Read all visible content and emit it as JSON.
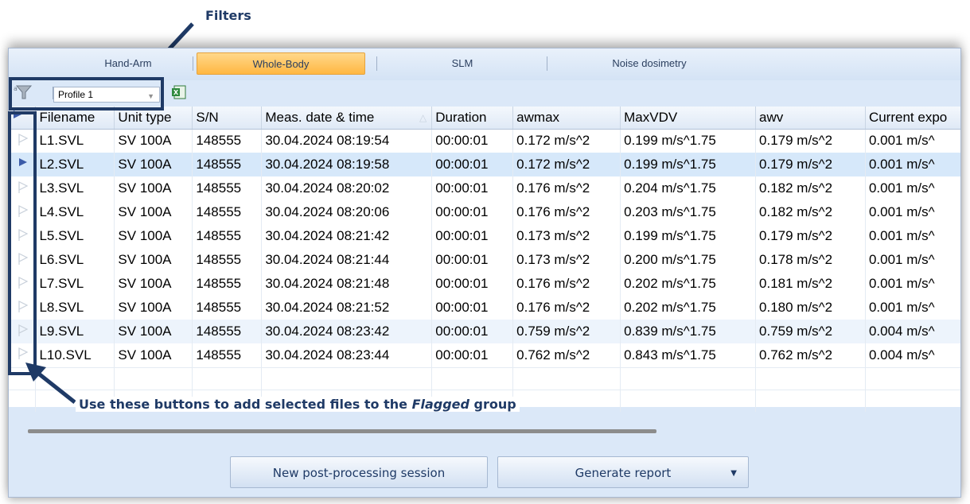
{
  "annotations": {
    "filters_label": "Filters",
    "flag_hint_prefix": "Use these buttons to add selected files to the ",
    "flag_hint_em": "Flagged",
    "flag_hint_suffix": " group"
  },
  "tabs": [
    "Hand-Arm",
    "Whole-Body",
    "SLM",
    "Noise dosimetry"
  ],
  "active_tab": "Whole-Body",
  "toolbar": {
    "profile_value": "Profile 1"
  },
  "table": {
    "columns": [
      "Filename",
      "Unit type",
      "S/N",
      "Meas. date & time",
      "Duration",
      "awmax",
      "MaxVDV",
      "awv",
      "Current expo"
    ],
    "rows": [
      [
        "L1.SVL",
        "SV 100A",
        "148555",
        "30.04.2024 08:19:54",
        "00:00:01",
        "0.172 m/s^2",
        "0.199 m/s^1.75",
        "0.179 m/s^2",
        "0.001 m/s^"
      ],
      [
        "L2.SVL",
        "SV 100A",
        "148555",
        "30.04.2024 08:19:58",
        "00:00:01",
        "0.172 m/s^2",
        "0.199 m/s^1.75",
        "0.179 m/s^2",
        "0.001 m/s^"
      ],
      [
        "L3.SVL",
        "SV 100A",
        "148555",
        "30.04.2024 08:20:02",
        "00:00:01",
        "0.176 m/s^2",
        "0.204 m/s^1.75",
        "0.182 m/s^2",
        "0.001 m/s^"
      ],
      [
        "L4.SVL",
        "SV 100A",
        "148555",
        "30.04.2024 08:20:06",
        "00:00:01",
        "0.176 m/s^2",
        "0.203 m/s^1.75",
        "0.182 m/s^2",
        "0.001 m/s^"
      ],
      [
        "L5.SVL",
        "SV 100A",
        "148555",
        "30.04.2024 08:21:42",
        "00:00:01",
        "0.173 m/s^2",
        "0.199 m/s^1.75",
        "0.179 m/s^2",
        "0.001 m/s^"
      ],
      [
        "L6.SVL",
        "SV 100A",
        "148555",
        "30.04.2024 08:21:44",
        "00:00:01",
        "0.173 m/s^2",
        "0.200 m/s^1.75",
        "0.178 m/s^2",
        "0.001 m/s^"
      ],
      [
        "L7.SVL",
        "SV 100A",
        "148555",
        "30.04.2024 08:21:48",
        "00:00:01",
        "0.176 m/s^2",
        "0.202 m/s^1.75",
        "0.181 m/s^2",
        "0.001 m/s^"
      ],
      [
        "L8.SVL",
        "SV 100A",
        "148555",
        "30.04.2024 08:21:52",
        "00:00:01",
        "0.176 m/s^2",
        "0.202 m/s^1.75",
        "0.180 m/s^2",
        "0.001 m/s^"
      ],
      [
        "L9.SVL",
        "SV 100A",
        "148555",
        "30.04.2024 08:23:42",
        "00:00:01",
        "0.759 m/s^2",
        "0.839 m/s^1.75",
        "0.759 m/s^2",
        "0.004 m/s^"
      ],
      [
        "L10.SVL",
        "SV 100A",
        "148555",
        "30.04.2024 08:23:44",
        "00:00:01",
        "0.762 m/s^2",
        "0.843 m/s^1.75",
        "0.762 m/s^2",
        "0.004 m/s^"
      ]
    ],
    "flagged_row": 1,
    "alt_row": 8
  },
  "buttons": {
    "new_session": "New post-processing session",
    "generate_report": "Generate report"
  },
  "colors": {
    "annotation": "#1f3a66",
    "active_tab": "#ffb742",
    "flag_active": "#3b5ba8",
    "flag_inactive": "#c8d0da"
  }
}
